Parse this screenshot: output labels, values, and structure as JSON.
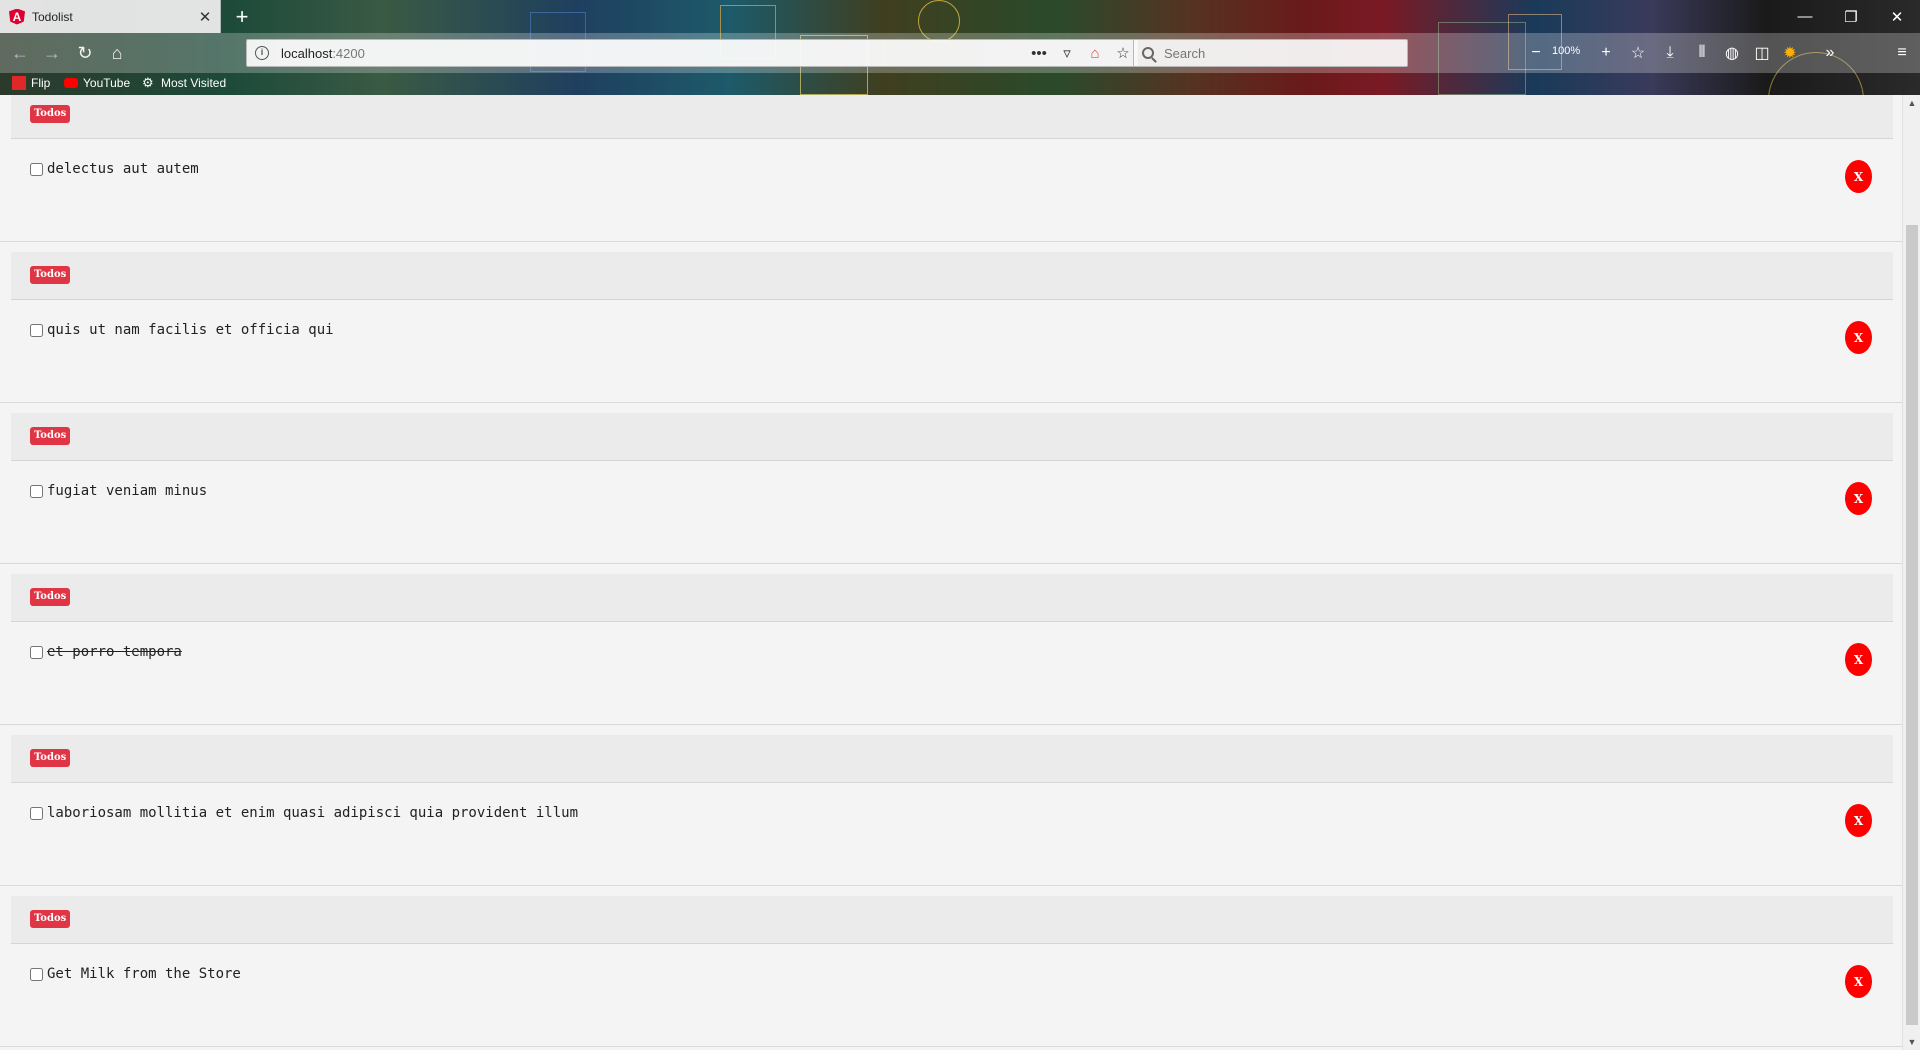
{
  "browser": {
    "tab_title": "Todolist",
    "tab_close": "✕",
    "new_tab": "+",
    "url_host": "localhost",
    "url_port": ":4200",
    "search_placeholder": "Search",
    "zoom_level": "100%",
    "window_controls": [
      "—",
      "❐",
      "✕"
    ],
    "bookmarks": [
      {
        "label": "Flip",
        "icon": "flipboard-icon"
      },
      {
        "label": "YouTube",
        "icon": "youtube-icon"
      },
      {
        "label": "Most Visited",
        "icon": "gear-icon"
      }
    ]
  },
  "todos": {
    "badge_label": "Todos",
    "delete_label": "X",
    "items": [
      {
        "title": "delectus aut autem",
        "completed": false
      },
      {
        "title": "quis ut nam facilis et officia qui",
        "completed": false
      },
      {
        "title": "fugiat veniam minus",
        "completed": false
      },
      {
        "title": "et porro tempora",
        "completed": true
      },
      {
        "title": "laboriosam mollitia et enim quasi adipisci quia provident illum",
        "completed": false
      },
      {
        "title": "Get Milk from the Store",
        "completed": false
      }
    ]
  },
  "colors": {
    "badge": "#e03545",
    "delete_button": "#ff0000",
    "angular_brand": "#dd0031"
  }
}
